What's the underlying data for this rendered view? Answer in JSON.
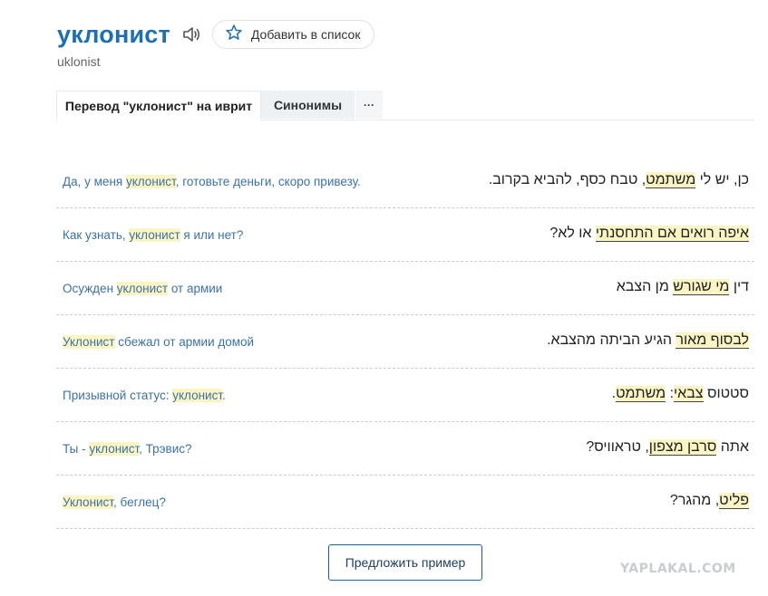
{
  "header": {
    "word": "уклонист",
    "transliteration": "uklonist",
    "add_to_list_label": "Добавить в список",
    "speaker_icon": "speaker-icon",
    "star_icon": "star-icon"
  },
  "tabs": [
    {
      "label": "Перевод \"уклонист\" на иврит"
    },
    {
      "label": "Синонимы"
    },
    {
      "label": "···"
    }
  ],
  "examples": [
    {
      "src": {
        "pre": "Да, у меня ",
        "hl": "уклонист",
        "post": ", готовьте деньги, скоро привезу."
      },
      "tgt": {
        "pre": "כן, יש לי ",
        "hl": "משתמט",
        "post": ", טבח כסף, להביא בקרוב."
      }
    },
    {
      "src": {
        "pre": "Как узнать, ",
        "hl": "уклонист",
        "post": " я или нет?"
      },
      "tgt": {
        "pre": "",
        "hl": "איפה רואים אם התחסנתי",
        "post": " או לא?"
      }
    },
    {
      "src": {
        "pre": "Осужден ",
        "hl": "уклонист",
        "post": " от армии"
      },
      "tgt": {
        "pre": "דין ",
        "hl": "מי שגורש",
        "post": " מן הצבא"
      }
    },
    {
      "src": {
        "pre": "",
        "hl": "Уклонист",
        "post": " сбежал от армии домой"
      },
      "tgt": {
        "pre": "",
        "hl": "לבסוף מאור",
        "post": " הגיע הביתה מהצבא."
      }
    },
    {
      "src": {
        "pre": "Призывной статус: ",
        "hl": "уклонист",
        "post": "."
      },
      "tgt": {
        "pre": "סטטוס ",
        "hl": "צבאי",
        "mid": ": ",
        "hl2": "משתמט",
        "post": "."
      }
    },
    {
      "src": {
        "pre": "Ты - ",
        "hl": "уклонист",
        "post": ", Трэвис?"
      },
      "tgt": {
        "pre": "אתה ",
        "hl": "סרבן מצפון",
        "post": ", טראוויס?"
      }
    },
    {
      "src": {
        "pre": "",
        "hl": "Уклонист",
        "post": ", беглец?"
      },
      "tgt": {
        "pre": "",
        "hl": "פליט",
        "post": ", מהגר?"
      }
    }
  ],
  "suggest_label": "Предложить пример",
  "watermark": "YAPLAKAL.COM",
  "colors": {
    "accent": "#1c6fb5",
    "highlight": "#fbf5c4",
    "source_text": "#3b72a6"
  }
}
